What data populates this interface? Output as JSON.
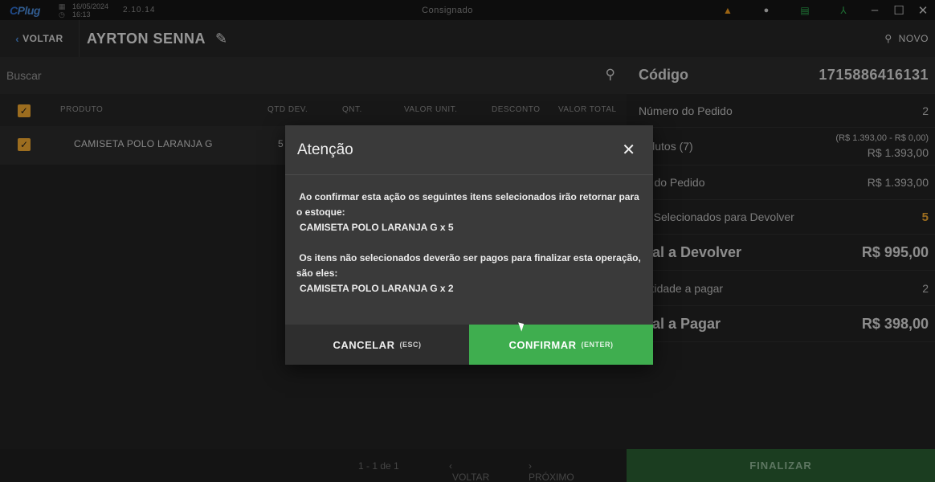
{
  "titlebar": {
    "logo": "Plug",
    "logo_c": "C",
    "date": "16/05/2024",
    "time": "16:13",
    "version": "2.10.14",
    "window_title": "Consignado",
    "icons": [
      "warning-icon",
      "bell-icon",
      "database-icon",
      "network-icon"
    ]
  },
  "header": {
    "back_label": "VOLTAR",
    "customer_name": "AYRTON SENNA",
    "new_label": "NOVO"
  },
  "search": {
    "placeholder": "Buscar"
  },
  "table": {
    "columns": [
      "PRODUTO",
      "QTD DEV.",
      "QNT.",
      "VALOR UNIT.",
      "DESCONTO",
      "VALOR TOTAL"
    ],
    "rows": [
      {
        "product": "CAMISETA POLO LARANJA G",
        "qtd_dev": "5"
      }
    ]
  },
  "pagination": {
    "range": "1 - 1 de 1",
    "prev": "VOLTAR",
    "next": "PRÓXIMO"
  },
  "summary": {
    "code_label": "Código",
    "code_value": "1715886416131",
    "order_number_label": "Número do Pedido",
    "order_number_value": "2",
    "products_label": "rodutos (7)",
    "products_detail": "(R$ 1.393,00 - R$ 0,00)",
    "products_value": "R$ 1.393,00",
    "order_value_label": "lor do Pedido",
    "order_value": "R$ 1.393,00",
    "selected_label": "ns Selecionados para Devolver",
    "selected_value": "5",
    "total_return_label": "otal a Devolver",
    "total_return_value": "R$ 995,00",
    "qty_pay_label": "antidade a pagar",
    "qty_pay_value": "2",
    "total_pay_label": "otal a Pagar",
    "total_pay_value": "R$ 398,00",
    "finalize_label": "FINALIZAR"
  },
  "modal": {
    "title": "Atenção",
    "line1": "Ao confirmar esta ação os seguintes itens selecionados irão retornar para o estoque:",
    "item1": "CAMISETA POLO LARANJA G x 5",
    "line2": "Os itens não selecionados deverão ser pagos para finalizar esta operação, são eles:",
    "item2": "CAMISETA POLO LARANJA G x 2",
    "cancel_label": "CANCELAR",
    "cancel_hint": "(ESC)",
    "confirm_label": "CONFIRMAR",
    "confirm_hint": "(ENTER)"
  },
  "colors": {
    "accent_orange": "#f0a830",
    "confirm_green": "#3fae4f",
    "finalize_green": "#2a5e32",
    "brand_blue": "#4a8ad8"
  }
}
